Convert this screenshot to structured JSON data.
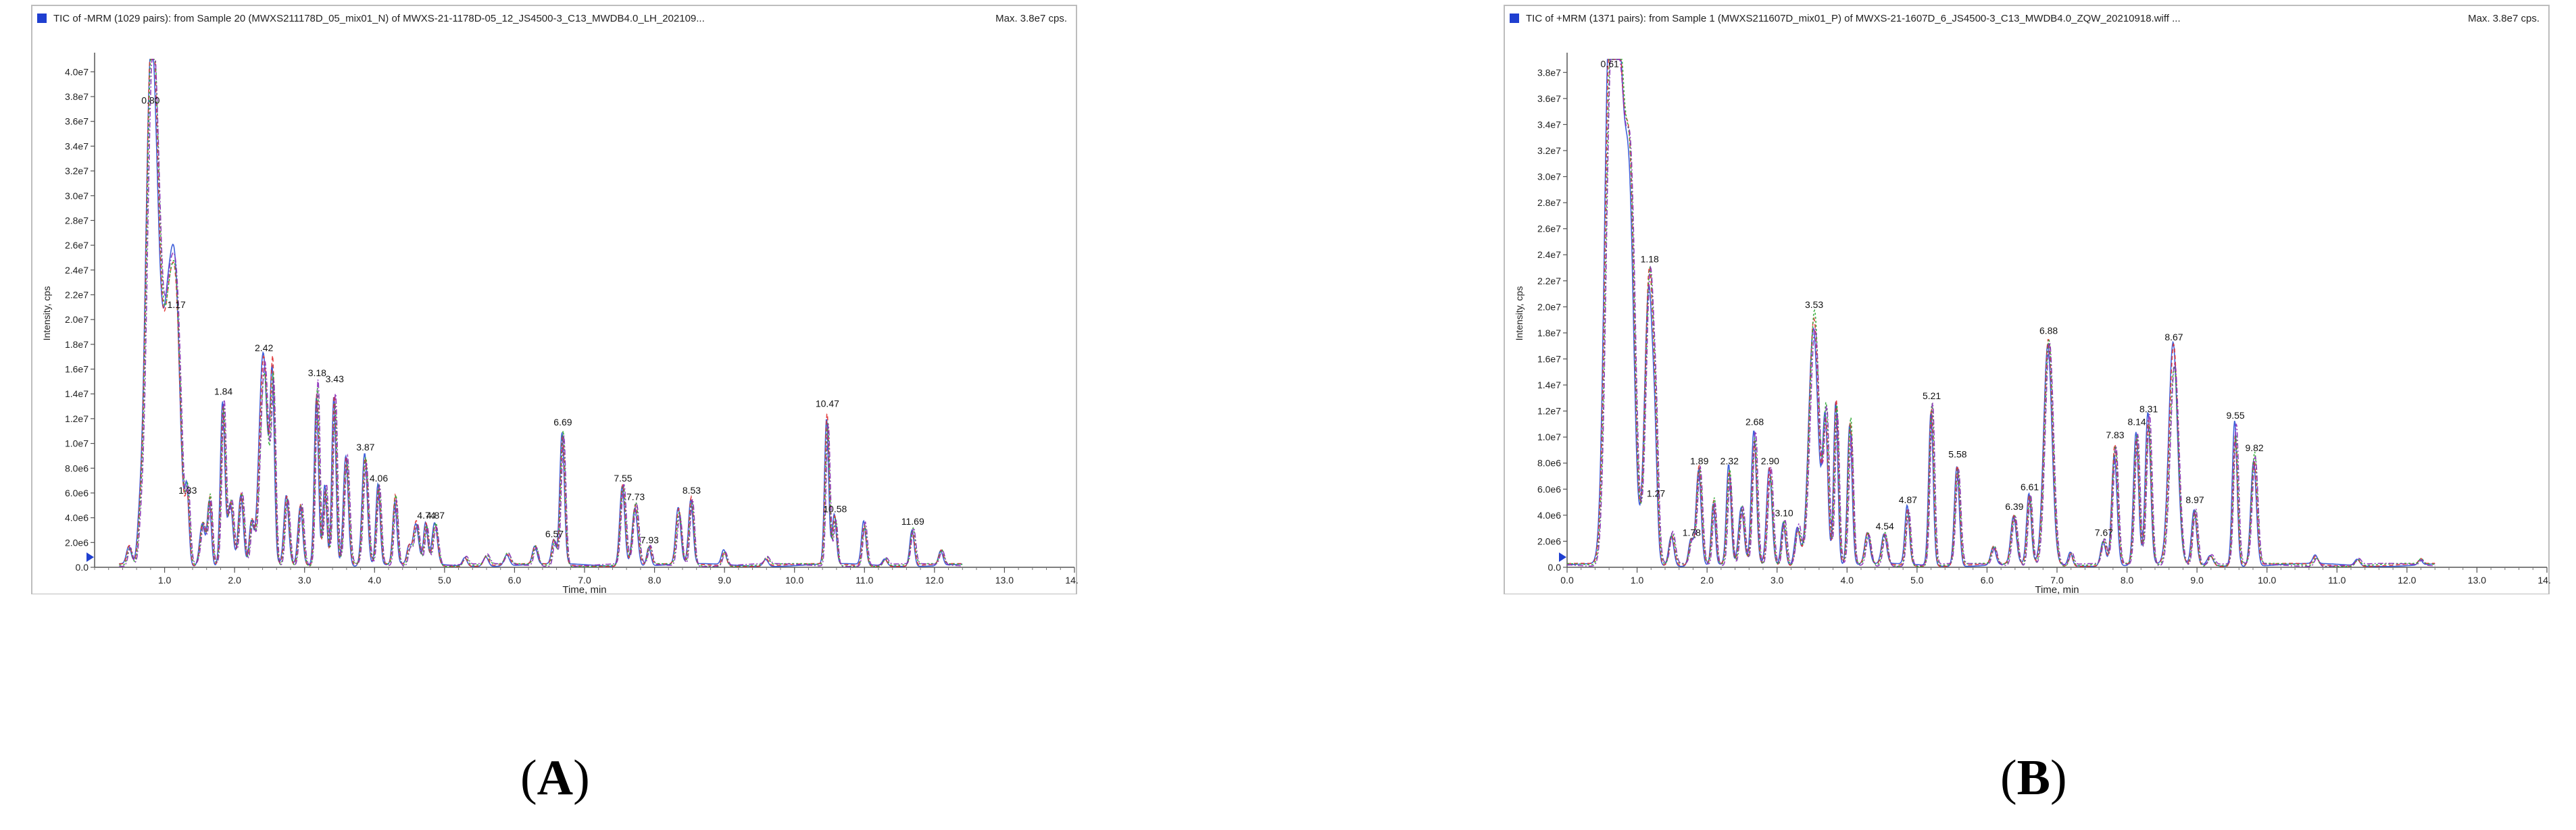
{
  "chart_data": [
    {
      "type": "line",
      "panel_label": "A",
      "title": "TIC of -MRM (1029 pairs): from Sample 20 (MWXS211178D_05_mix01_N) of MWXS-21-1178D-05_12_JS4500-3_C13_MWDB4.0_LH_202109...",
      "max_label": "Max. 3.8e7 cps.",
      "xlabel": "Time, min",
      "ylabel": "Intensity, cps",
      "xlim": [
        0,
        14
      ],
      "ylim": [
        0,
        41000000.0
      ],
      "xticks": [
        1.0,
        2.0,
        3.0,
        4.0,
        5.0,
        6.0,
        7.0,
        8.0,
        9.0,
        10.0,
        11.0,
        12.0,
        13.0,
        14.0
      ],
      "xtick_labels": [
        "1.0",
        "2.0",
        "3.0",
        "4.0",
        "5.0",
        "6.0",
        "7.0",
        "8.0",
        "9.0",
        "10.0",
        "11.0",
        "12.0",
        "13.0",
        "14.0"
      ],
      "yticks": [
        0,
        2000000,
        4000000,
        6000000,
        8000000,
        10000000,
        12000000,
        14000000,
        16000000,
        18000000,
        20000000,
        22000000,
        24000000,
        26000000,
        28000000,
        30000000,
        32000000,
        34000000,
        36000000,
        38000000,
        40000000
      ],
      "ytick_labels": [
        "0.0",
        "2.0e6",
        "4.0e6",
        "6.0e6",
        "8.0e6",
        "1.0e7",
        "1.2e7",
        "1.4e7",
        "1.6e7",
        "1.8e7",
        "2.0e7",
        "2.2e7",
        "2.4e7",
        "2.6e7",
        "2.8e7",
        "3.0e7",
        "3.2e7",
        "3.4e7",
        "3.6e7",
        "3.8e7",
        "4.0e7"
      ],
      "series_colors": [
        "#2a4fd6",
        "#e03030",
        "#2aa830",
        "#8a2bb8"
      ],
      "peaks": [
        {
          "x": 0.5,
          "y": 1500000
        },
        {
          "x": 0.65,
          "y": 2000000
        },
        {
          "x": 0.8,
          "y": 37000000,
          "label": "0.80"
        },
        {
          "x": 0.9,
          "y": 21500000
        },
        {
          "x": 1.05,
          "y": 19000000
        },
        {
          "x": 1.17,
          "y": 20500000,
          "label": "1.17"
        },
        {
          "x": 1.33,
          "y": 5500000,
          "label": "1.33"
        },
        {
          "x": 1.55,
          "y": 3500000
        },
        {
          "x": 1.65,
          "y": 5500000
        },
        {
          "x": 1.84,
          "y": 13500000,
          "label": "1.84"
        },
        {
          "x": 1.95,
          "y": 5500000
        },
        {
          "x": 2.1,
          "y": 6000000
        },
        {
          "x": 2.25,
          "y": 3500000
        },
        {
          "x": 2.42,
          "y": 17000000,
          "label": "2.42"
        },
        {
          "x": 2.55,
          "y": 15000000
        },
        {
          "x": 2.75,
          "y": 5500000
        },
        {
          "x": 2.95,
          "y": 5000000
        },
        {
          "x": 3.18,
          "y": 15000000,
          "label": "3.18"
        },
        {
          "x": 3.3,
          "y": 6500000
        },
        {
          "x": 3.43,
          "y": 14500000,
          "label": "3.43"
        },
        {
          "x": 3.6,
          "y": 9000000
        },
        {
          "x": 3.87,
          "y": 9000000,
          "label": "3.87"
        },
        {
          "x": 4.06,
          "y": 6500000,
          "label": "4.06"
        },
        {
          "x": 4.3,
          "y": 5500000
        },
        {
          "x": 4.5,
          "y": 1500000
        },
        {
          "x": 4.6,
          "y": 3500000
        },
        {
          "x": 4.74,
          "y": 3500000,
          "label": "4.74"
        },
        {
          "x": 4.87,
          "y": 3500000,
          "label": "4.87"
        },
        {
          "x": 5.3,
          "y": 700000
        },
        {
          "x": 5.6,
          "y": 800000
        },
        {
          "x": 5.9,
          "y": 900000
        },
        {
          "x": 6.3,
          "y": 1500000
        },
        {
          "x": 6.57,
          "y": 2000000,
          "label": "6.57"
        },
        {
          "x": 6.69,
          "y": 11000000,
          "label": "6.69"
        },
        {
          "x": 7.55,
          "y": 6500000,
          "label": "7.55"
        },
        {
          "x": 7.73,
          "y": 5000000,
          "label": "7.73"
        },
        {
          "x": 7.93,
          "y": 1500000,
          "label": "7.93"
        },
        {
          "x": 8.35,
          "y": 4500000
        },
        {
          "x": 8.53,
          "y": 5500000,
          "label": "8.53"
        },
        {
          "x": 9.0,
          "y": 1200000
        },
        {
          "x": 9.6,
          "y": 600000
        },
        {
          "x": 10.47,
          "y": 12500000,
          "label": "10.47"
        },
        {
          "x": 10.58,
          "y": 4000000,
          "label": "10.58"
        },
        {
          "x": 11.0,
          "y": 3500000
        },
        {
          "x": 11.3,
          "y": 600000
        },
        {
          "x": 11.69,
          "y": 3000000,
          "label": "11.69"
        },
        {
          "x": 12.1,
          "y": 1200000
        }
      ]
    },
    {
      "type": "line",
      "panel_label": "B",
      "title": "TIC of +MRM (1371 pairs): from Sample 1 (MWXS211607D_mix01_P) of MWXS-21-1607D_6_JS4500-3_C13_MWDB4.0_ZQW_20210918.wiff ...",
      "max_label": "Max. 3.8e7 cps.",
      "xlabel": "Time, min",
      "ylabel": "Intensity, cps",
      "xlim": [
        0,
        14
      ],
      "ylim": [
        0,
        39000000.0
      ],
      "xticks": [
        0.0,
        1.0,
        2.0,
        3.0,
        4.0,
        5.0,
        6.0,
        7.0,
        8.0,
        9.0,
        10.0,
        11.0,
        12.0,
        13.0,
        14.0
      ],
      "xtick_labels": [
        "0.0",
        "1.0",
        "2.0",
        "3.0",
        "4.0",
        "5.0",
        "6.0",
        "7.0",
        "8.0",
        "9.0",
        "10.0",
        "11.0",
        "12.0",
        "13.0",
        "14.0"
      ],
      "yticks": [
        0,
        2000000,
        4000000,
        6000000,
        8000000,
        10000000,
        12000000,
        14000000,
        16000000,
        18000000,
        20000000,
        22000000,
        24000000,
        26000000,
        28000000,
        30000000,
        32000000,
        34000000,
        36000000,
        38000000
      ],
      "ytick_labels": [
        "0.0",
        "2.0e6",
        "4.0e6",
        "6.0e6",
        "8.0e6",
        "1.0e7",
        "1.2e7",
        "1.4e7",
        "1.6e7",
        "1.8e7",
        "2.0e7",
        "2.2e7",
        "2.4e7",
        "2.6e7",
        "2.8e7",
        "3.0e7",
        "3.2e7",
        "3.4e7",
        "3.6e7",
        "3.8e7"
      ],
      "series_colors": [
        "#2a4fd6",
        "#e03030",
        "#2aa830",
        "#8a2bb8"
      ],
      "peaks": [
        {
          "x": 0.61,
          "y": 38000000,
          "label": "0.61"
        },
        {
          "x": 0.75,
          "y": 35500000
        },
        {
          "x": 0.9,
          "y": 29000000
        },
        {
          "x": 1.18,
          "y": 23000000,
          "label": "1.18"
        },
        {
          "x": 1.27,
          "y": 5000000,
          "label": "1.27"
        },
        {
          "x": 1.5,
          "y": 2500000
        },
        {
          "x": 1.78,
          "y": 2000000,
          "label": "1.78"
        },
        {
          "x": 1.89,
          "y": 7500000,
          "label": "1.89"
        },
        {
          "x": 2.1,
          "y": 5000000
        },
        {
          "x": 2.32,
          "y": 7500000,
          "label": "2.32"
        },
        {
          "x": 2.5,
          "y": 4500000
        },
        {
          "x": 2.68,
          "y": 10500000,
          "label": "2.68"
        },
        {
          "x": 2.9,
          "y": 7500000,
          "label": "2.90"
        },
        {
          "x": 3.1,
          "y": 3500000,
          "label": "3.10"
        },
        {
          "x": 3.3,
          "y": 3000000
        },
        {
          "x": 3.53,
          "y": 19500000,
          "label": "3.53"
        },
        {
          "x": 3.7,
          "y": 11500000
        },
        {
          "x": 3.85,
          "y": 12500000
        },
        {
          "x": 4.05,
          "y": 11000000
        },
        {
          "x": 4.3,
          "y": 2500000
        },
        {
          "x": 4.54,
          "y": 2500000,
          "label": "4.54"
        },
        {
          "x": 4.87,
          "y": 4500000,
          "label": "4.87"
        },
        {
          "x": 5.21,
          "y": 12500000,
          "label": "5.21"
        },
        {
          "x": 5.58,
          "y": 8000000,
          "label": "5.58"
        },
        {
          "x": 6.1,
          "y": 1500000
        },
        {
          "x": 6.39,
          "y": 4000000,
          "label": "6.39"
        },
        {
          "x": 6.61,
          "y": 5500000,
          "label": "6.61"
        },
        {
          "x": 6.88,
          "y": 17500000,
          "label": "6.88"
        },
        {
          "x": 7.2,
          "y": 1000000
        },
        {
          "x": 7.67,
          "y": 2000000,
          "label": "7.67"
        },
        {
          "x": 7.83,
          "y": 9500000,
          "label": "7.83"
        },
        {
          "x": 8.14,
          "y": 10500000,
          "label": "8.14"
        },
        {
          "x": 8.31,
          "y": 11500000,
          "label": "8.31"
        },
        {
          "x": 8.67,
          "y": 17000000,
          "label": "8.67"
        },
        {
          "x": 8.97,
          "y": 4500000,
          "label": "8.97"
        },
        {
          "x": 9.2,
          "y": 800000
        },
        {
          "x": 9.55,
          "y": 11000000,
          "label": "9.55"
        },
        {
          "x": 9.82,
          "y": 8500000,
          "label": "9.82"
        },
        {
          "x": 10.7,
          "y": 700000
        },
        {
          "x": 11.3,
          "y": 500000
        },
        {
          "x": 12.2,
          "y": 400000
        }
      ]
    }
  ]
}
